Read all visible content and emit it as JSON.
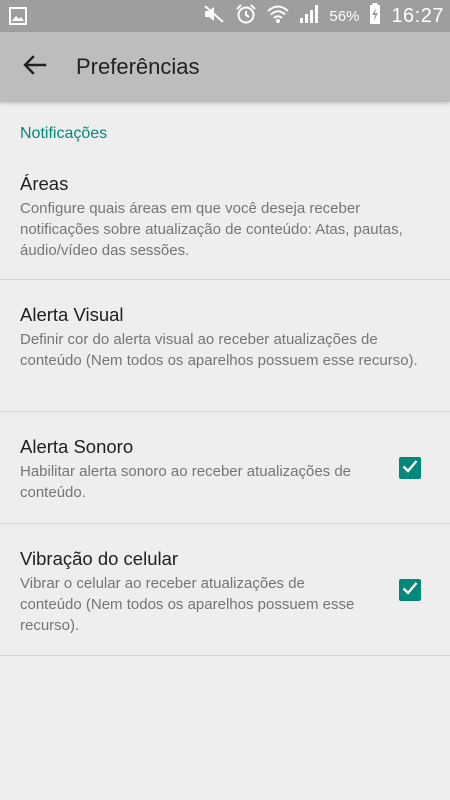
{
  "status_bar": {
    "battery_percent": "56%",
    "time": "16:27",
    "icons": [
      "image-icon",
      "mute-icon",
      "alarm-icon",
      "wifi-icon",
      "signal-icon",
      "battery-charging-icon"
    ]
  },
  "app_bar": {
    "title": "Preferências",
    "back_icon": "arrow-back-icon",
    "background": "#bdbdbd"
  },
  "category": {
    "title": "Notificações",
    "color": "#00897b"
  },
  "preferences": [
    {
      "title": "Áreas",
      "summary": "Configure quais áreas em que você deseja receber notificações sobre atualização de conteúdo: Atas, pautas, áudio/vídeo das sessões.",
      "has_checkbox": false
    },
    {
      "title": "Alerta Visual",
      "summary": "Definir cor do alerta visual ao receber atualizações de conteúdo (Nem todos os aparelhos possuem esse recurso).",
      "has_checkbox": false
    },
    {
      "title": "Alerta Sonoro",
      "summary": "Habilitar alerta sonoro ao receber atualizações de conteúdo.",
      "has_checkbox": true,
      "checked": true
    },
    {
      "title": "Vibração do celular",
      "summary": "Vibrar o celular ao receber atualizações de conteúdo (Nem todos os aparelhos possuem esse recurso).",
      "has_checkbox": true,
      "checked": true
    }
  ]
}
